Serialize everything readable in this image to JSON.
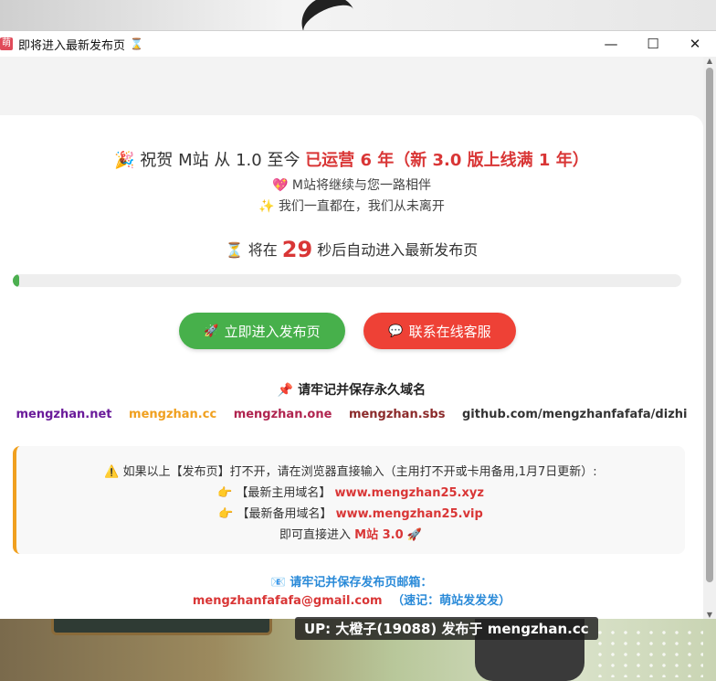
{
  "window": {
    "app_icon_text": "萌",
    "title": "即将进入最新发布页",
    "title_icon": "⌛",
    "minimize": "—",
    "maximize": "☐",
    "close": "✕"
  },
  "headline": {
    "emoji": "🎉",
    "prefix": "祝贺 M站 从 1.0 至今",
    "highlight": "已运营 6 年（新 3.0 版上线满 1 年）"
  },
  "lines": {
    "line1_emoji": "💖",
    "line1": "M站将继续与您一路相伴",
    "line2_emoji": "✨",
    "line2": "我们一直都在，我们从未离开"
  },
  "countdown": {
    "emoji": "⏳",
    "before": "将在",
    "seconds": "29",
    "after": "秒后自动进入最新发布页",
    "progress_percent": 1
  },
  "buttons": {
    "enter_icon": "🚀",
    "enter_label": "立即进入发布页",
    "contact_icon": "💬",
    "contact_label": "联系在线客服"
  },
  "domains": {
    "title_emoji": "📌",
    "title": "请牢记并保存永久域名",
    "items": [
      {
        "text": "mengzhan.net",
        "color": "#6a1b9a"
      },
      {
        "text": "mengzhan.cc",
        "color": "#f0a01f"
      },
      {
        "text": "mengzhan.one",
        "color": "#b0244f"
      },
      {
        "text": "mengzhan.sbs",
        "color": "#8b2a2a"
      },
      {
        "text": "github.com/mengzhanfafafa/dizhi",
        "color": "#333333"
      }
    ]
  },
  "notice": {
    "warn_emoji": "⚠️",
    "line1": "如果以上【发布页】打不开，请在浏览器直接输入（主用打不开或卡用备用,1月7日更新）:",
    "point_emoji": "👉",
    "main_label": "【最新主用域名】",
    "main_domain": "www.mengzhan25.xyz",
    "backup_label": "【最新备用域名】",
    "backup_domain": "www.mengzhan25.vip",
    "last_prefix": "即可直接进入",
    "last_highlight": "M站 3.0",
    "last_emoji": "🚀"
  },
  "mail": {
    "emoji": "📧",
    "title": "请牢记并保存发布页邮箱：",
    "address": "mengzhanfafafa@gmail.com",
    "note": "（速记：萌站发发发）"
  },
  "caption": "UP: 大橙子(19088) 发布于 mengzhan.cc",
  "colors": {
    "accent_red": "#d93636",
    "green": "#47b04b",
    "red_button": "#ee4136",
    "mail_blue": "#2a8ad8",
    "notice_border": "#f0a01f"
  }
}
